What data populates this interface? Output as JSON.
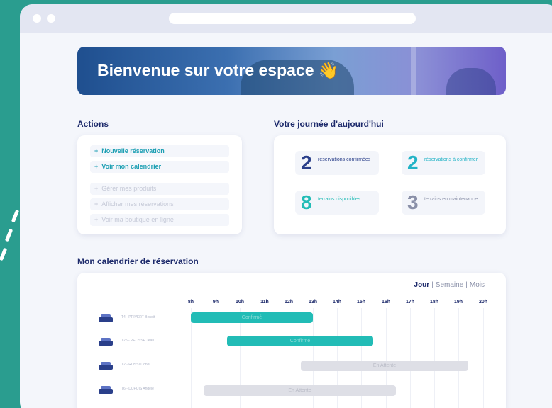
{
  "banner": {
    "title": "Bienvenue sur votre espace 👋"
  },
  "actions": {
    "title": "Actions",
    "items": [
      {
        "label": "Nouvelle réservation"
      },
      {
        "label": "Voir mon calendrier"
      },
      {
        "label": "Gérer mes produits"
      },
      {
        "label": "Afficher mes réservations"
      },
      {
        "label": "Voir ma boutique en ligne"
      }
    ]
  },
  "day": {
    "title": "Votre journée d'aujourd'hui",
    "stats": [
      {
        "value": "2",
        "label": "réservations confirmées",
        "color": "#2a3f8a"
      },
      {
        "value": "2",
        "label": "réservations à confirmer",
        "color": "#22b3c6"
      },
      {
        "value": "8",
        "label": "terrains disponibles",
        "color": "#22bcb6"
      },
      {
        "value": "3",
        "label": "terrains en maintenance",
        "color": "#8a90a8"
      }
    ]
  },
  "calendar": {
    "title": "Mon calendrier de réservation",
    "views": {
      "day": "Jour",
      "week": "Semaine",
      "month": "Mois",
      "separator": "|"
    },
    "hours": [
      "8h",
      "9h",
      "10h",
      "11h",
      "12h",
      "13h",
      "14h",
      "15h",
      "16h",
      "17h",
      "18h",
      "19h",
      "20h"
    ],
    "rooms": [
      {
        "label": "T4 - PRIVERT Benoit"
      },
      {
        "label": "T25 - PELISSE Jean"
      },
      {
        "label": "T2 - ROSSI Lionel"
      },
      {
        "label": "T6 - DUPUIS Angèle"
      }
    ],
    "bars": [
      {
        "label": "Confirmé",
        "status": "teal"
      },
      {
        "label": "Confirmé",
        "status": "teal"
      },
      {
        "label": "En Attente",
        "status": "gray"
      },
      {
        "label": "En Attente",
        "status": "gray"
      }
    ]
  },
  "colors": {
    "background": "#2a9d8f",
    "accent": "#22bcb6",
    "navy": "#1d2a6b"
  }
}
